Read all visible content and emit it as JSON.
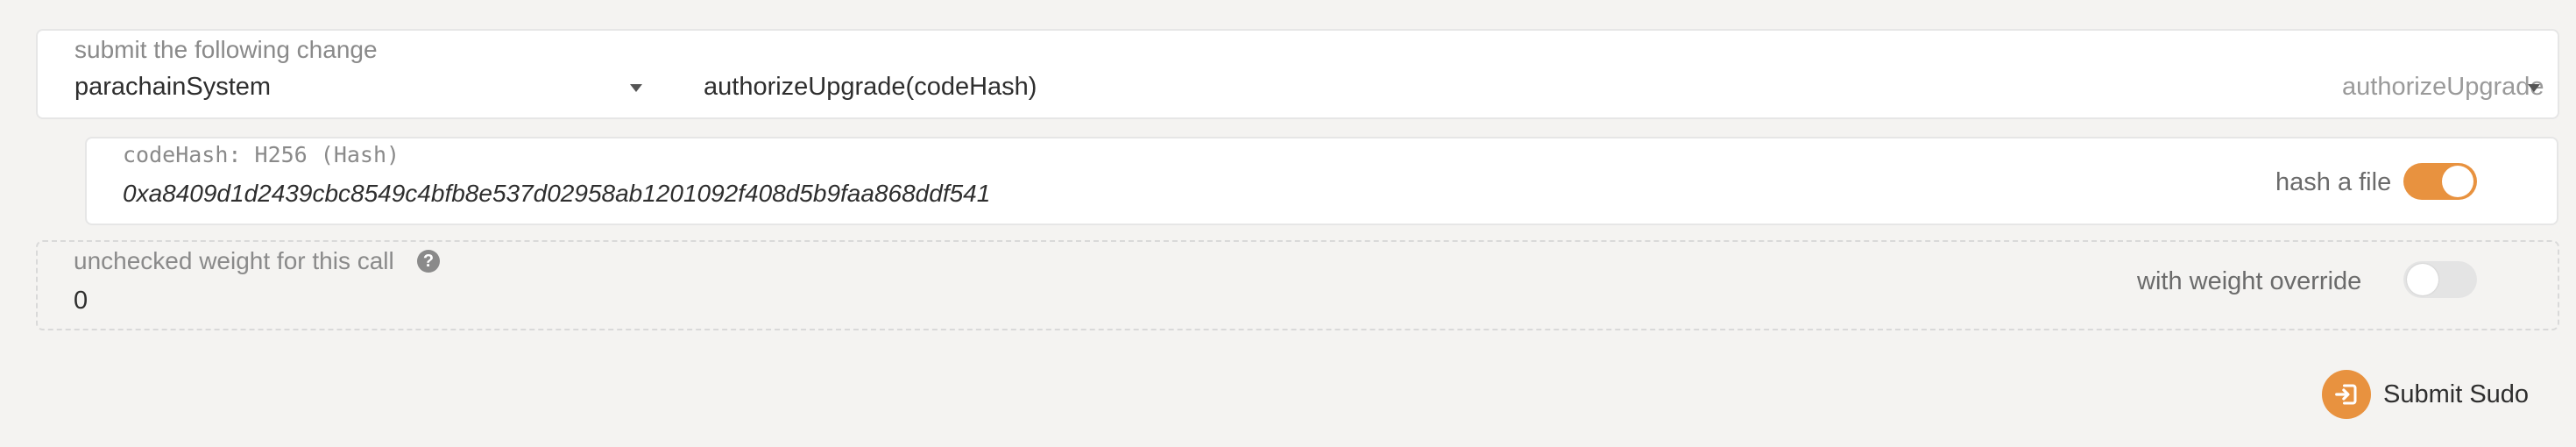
{
  "extrinsic": {
    "label": "submit the following change",
    "module": "parachainSystem",
    "call_signature": "authorizeUpgrade(codeHash)",
    "method": "authorizeUpgrade"
  },
  "param": {
    "label": "codeHash: H256 (Hash)",
    "value": "0xa8409d1d2439cbc8549c4bfb8e537d02958ab1201092f408d5b9faa868ddf541",
    "toggle_label": "hash a file",
    "toggle_on": true
  },
  "weight": {
    "label": "unchecked weight for this call",
    "help_glyph": "?",
    "value": "0",
    "toggle_label": "with weight override",
    "toggle_on": false
  },
  "submit": {
    "label": "Submit Sudo"
  },
  "colors": {
    "accent": "#e8923f",
    "background": "#f4f3f1"
  },
  "icons": {
    "module_dropdown": "chevron-down-icon",
    "method_dropdown": "chevron-down-icon",
    "help": "question-circle-icon",
    "submit": "sign-in-icon"
  }
}
